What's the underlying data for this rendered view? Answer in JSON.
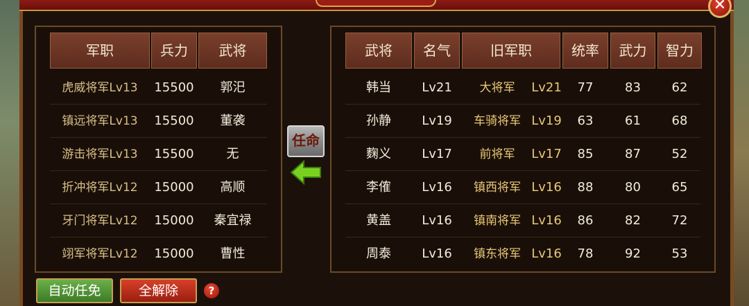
{
  "close_glyph": "✕",
  "left_table": {
    "headers": [
      "军职",
      "兵力",
      "武将"
    ],
    "rows": [
      {
        "position": "虎威将军Lv13",
        "troops": "15500",
        "general": "郭汜"
      },
      {
        "position": "镇远将军Lv13",
        "troops": "15500",
        "general": "董袭"
      },
      {
        "position": "游击将军Lv13",
        "troops": "15500",
        "general": "无"
      },
      {
        "position": "折冲将军Lv12",
        "troops": "15000",
        "general": "高顺"
      },
      {
        "position": "牙门将军Lv12",
        "troops": "15000",
        "general": "秦宜禄"
      },
      {
        "position": "翊军将军Lv12",
        "troops": "15000",
        "general": "曹性"
      }
    ]
  },
  "right_table": {
    "headers": [
      "武将",
      "名气",
      "旧军职",
      "统率",
      "武力",
      "智力"
    ],
    "rows": [
      {
        "general": "韩当",
        "fame": "Lv21",
        "old_position": "大将军",
        "old_level": "Lv21",
        "command": "77",
        "force": "83",
        "intellect": "62"
      },
      {
        "general": "孙静",
        "fame": "Lv19",
        "old_position": "车骑将军",
        "old_level": "Lv19",
        "command": "63",
        "force": "61",
        "intellect": "68"
      },
      {
        "general": "麴义",
        "fame": "Lv17",
        "old_position": "前将军",
        "old_level": "Lv17",
        "command": "85",
        "force": "87",
        "intellect": "52"
      },
      {
        "general": "李傕",
        "fame": "Lv16",
        "old_position": "镇西将军",
        "old_level": "Lv16",
        "command": "88",
        "force": "80",
        "intellect": "65"
      },
      {
        "general": "黄盖",
        "fame": "Lv16",
        "old_position": "镇南将军",
        "old_level": "Lv16",
        "command": "86",
        "force": "82",
        "intellect": "72"
      },
      {
        "general": "周泰",
        "fame": "Lv16",
        "old_position": "镇东将军",
        "old_level": "Lv16",
        "command": "78",
        "force": "92",
        "intellect": "53"
      }
    ]
  },
  "appoint_label": "任命",
  "buttons": {
    "auto_label": "自动任免",
    "clear_label": "全解除"
  },
  "help_glyph": "?",
  "colors": {
    "gold_text": "#e8c878",
    "header_bg": "#7a3f2c",
    "arrow_green": "#7ad020"
  }
}
